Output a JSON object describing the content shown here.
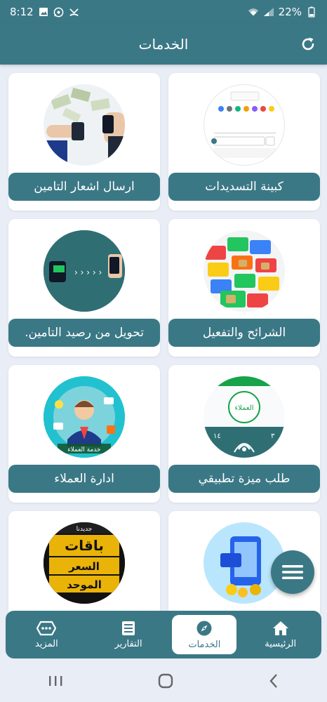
{
  "status": {
    "time": "8:12",
    "battery": "22%"
  },
  "header": {
    "title": "الخدمات"
  },
  "cards": [
    {
      "label": "كبينة التسديدات"
    },
    {
      "label": "ارسال اشعار التامين"
    },
    {
      "label": "الشرائح والتفعيل"
    },
    {
      "label": "تحويل من رصيد التامين."
    },
    {
      "label": "طلب ميزة تطبيقي"
    },
    {
      "label": "ادارة العملاء"
    }
  ],
  "thumbs": {
    "customers_caption": "خدمة العملاء",
    "packages_line1": "باقات",
    "packages_line2": "السعر",
    "packages_line3": "الموحد",
    "packages_badge": "جديدنا",
    "feature_top": "العملاء"
  },
  "bottom_nav": [
    {
      "label": "المزيد",
      "icon": "more-icon"
    },
    {
      "label": "التقارير",
      "icon": "reports-icon"
    },
    {
      "label": "الخدمات",
      "icon": "compass-icon"
    },
    {
      "label": "الرئيسية",
      "icon": "home-icon"
    }
  ],
  "colors": {
    "primary": "#3b7886",
    "background": "#e8edf6"
  }
}
